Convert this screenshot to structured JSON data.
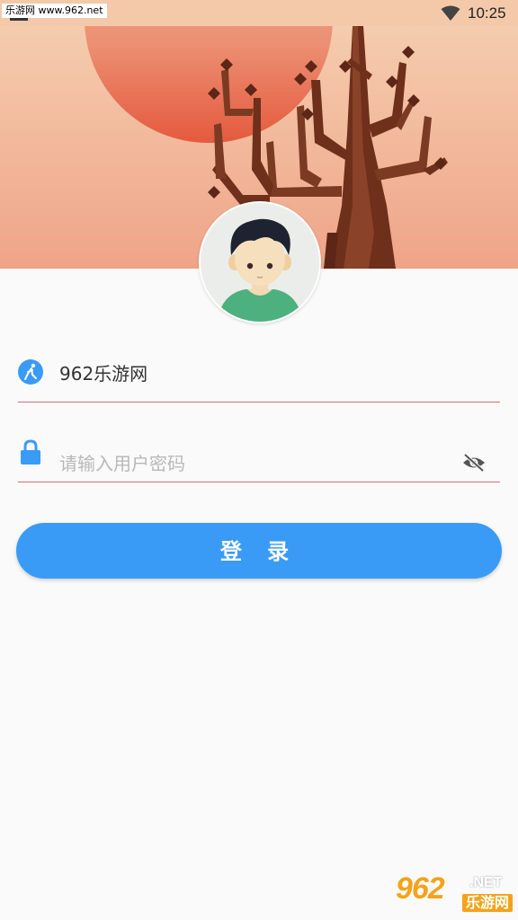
{
  "statusbar": {
    "watermark": "乐游网 www.962.net",
    "time": "10:25"
  },
  "login": {
    "username_value": "962乐游网",
    "password_placeholder": "请输入用户密码",
    "login_label": "登 录"
  },
  "watermark": {
    "number": "962",
    "domain": ".NET",
    "brand": "乐游网"
  },
  "icons": [
    "wifi-icon",
    "user-icon",
    "lock-icon",
    "eye-off-icon",
    "avatar"
  ],
  "colors": {
    "accent": "#3a9bf7",
    "underline": "#e06a6a",
    "hero_sky": "#f3bf9c",
    "sun": "#e8775c",
    "tree": "#7a3b22"
  }
}
